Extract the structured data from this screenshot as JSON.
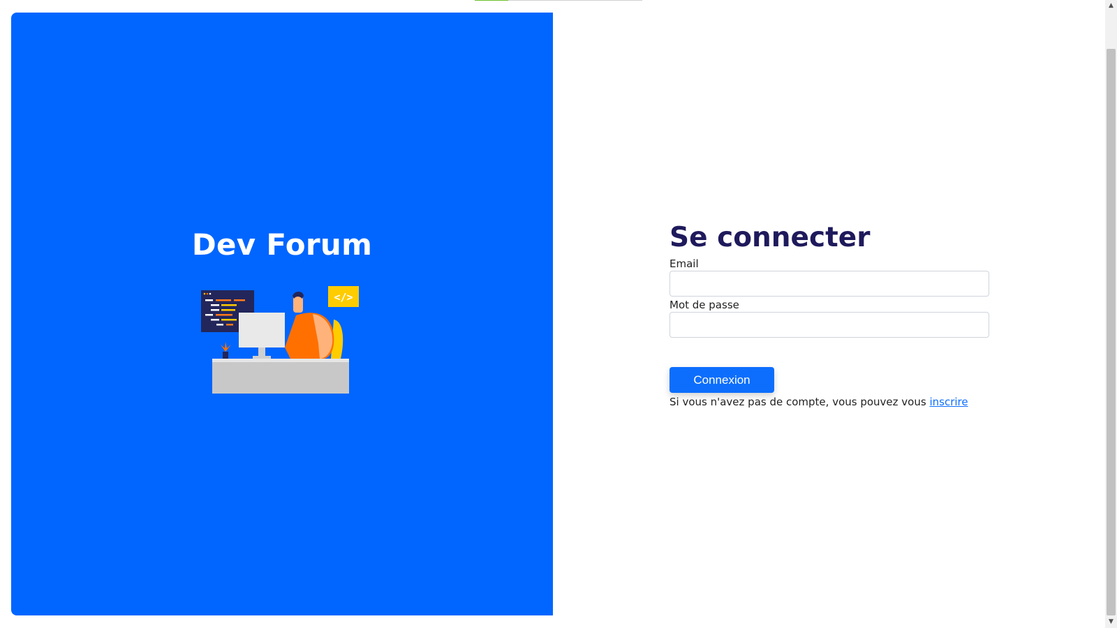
{
  "brand": {
    "title": "Dev Forum"
  },
  "illustration": {
    "icon": "developer-at-desk-illustration",
    "badge_text": "</>"
  },
  "login_form": {
    "title": "Se connecter",
    "email_label": "Email",
    "email_value": "",
    "password_label": "Mot de passe",
    "password_value": "",
    "submit_label": "Connexion",
    "signup_prompt": "Si vous n'avez pas de compte, vous pouvez vous",
    "signup_link": "inscrire"
  },
  "scrollbar": {
    "up_icon": "▲",
    "down_icon": "▼"
  },
  "colors": {
    "brand_panel": "#0066ff",
    "title_text": "#1f1a5c",
    "button": "#0d6efd"
  }
}
